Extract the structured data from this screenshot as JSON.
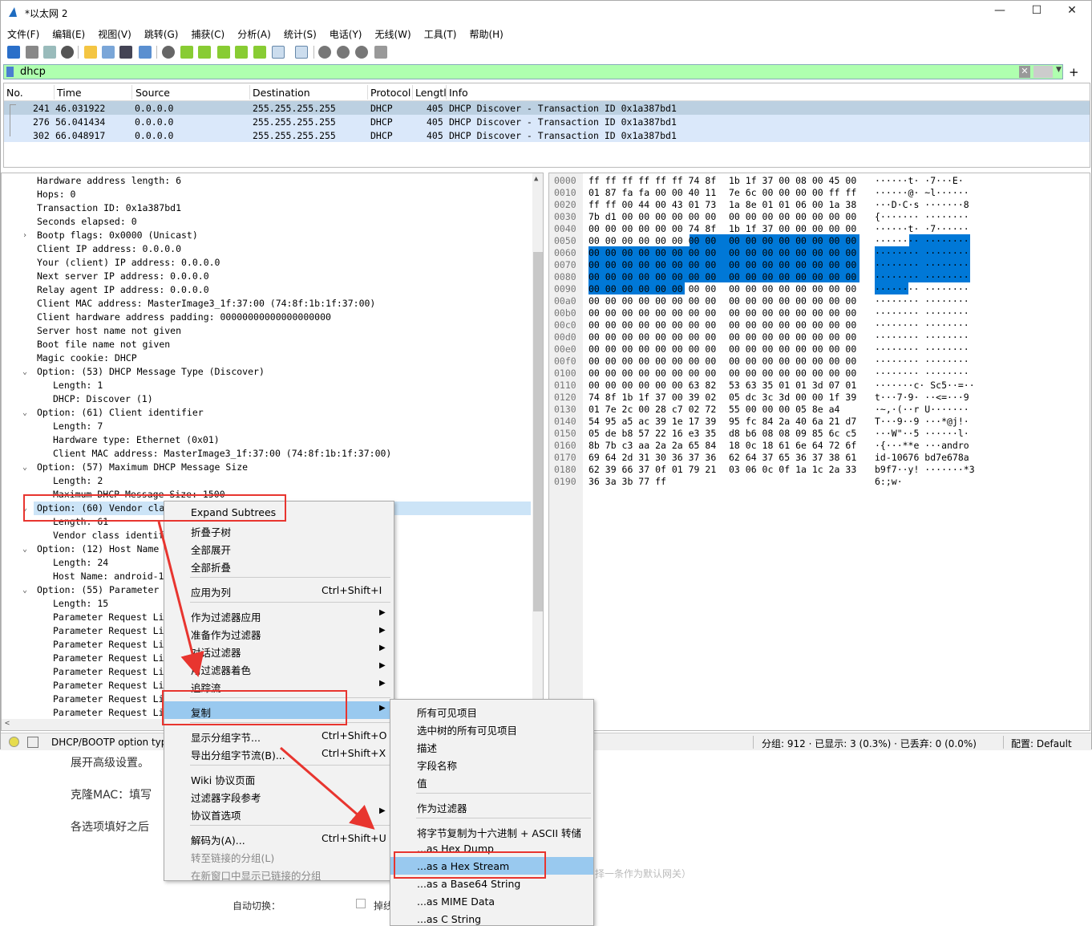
{
  "window": {
    "title": "*以太网 2",
    "minimize": "—",
    "maximize": "☐",
    "close": "✕"
  },
  "menubar": [
    "文件(F)",
    "编辑(E)",
    "视图(V)",
    "跳转(G)",
    "捕获(C)",
    "分析(A)",
    "统计(S)",
    "电话(Y)",
    "无线(W)",
    "工具(T)",
    "帮助(H)"
  ],
  "filter": {
    "value": "dhcp"
  },
  "packet_list": {
    "columns": [
      "No.",
      "Time",
      "Source",
      "Destination",
      "Protocol",
      "Lengtl",
      "Info"
    ],
    "rows": [
      {
        "no": "241",
        "time": "46.031922",
        "src": "0.0.0.0",
        "dst": "255.255.255.255",
        "proto": "DHCP",
        "len": "405",
        "info": "DHCP Discover - Transaction ID 0x1a387bd1"
      },
      {
        "no": "276",
        "time": "56.041434",
        "src": "0.0.0.0",
        "dst": "255.255.255.255",
        "proto": "DHCP",
        "len": "405",
        "info": "DHCP Discover - Transaction ID 0x1a387bd1"
      },
      {
        "no": "302",
        "time": "66.048917",
        "src": "0.0.0.0",
        "dst": "255.255.255.255",
        "proto": "DHCP",
        "len": "405",
        "info": "DHCP Discover - Transaction ID 0x1a387bd1"
      }
    ]
  },
  "details": [
    "Hardware address length: 6",
    "Hops: 0",
    "Transaction ID: 0x1a387bd1",
    "Seconds elapsed: 0",
    "Bootp flags: 0x0000 (Unicast)",
    "Client IP address: 0.0.0.0",
    "Your (client) IP address: 0.0.0.0",
    "Next server IP address: 0.0.0.0",
    "Relay agent IP address: 0.0.0.0",
    "Client MAC address: MasterImage3_1f:37:00 (74:8f:1b:1f:37:00)",
    "Client hardware address padding: 00000000000000000000",
    "Server host name not given",
    "Boot file name not given",
    "Magic cookie: DHCP",
    "Option: (53) DHCP Message Type (Discover)",
    "Length: 1",
    "DHCP: Discover (1)",
    "Option: (61) Client identifier",
    "Length: 7",
    "Hardware type: Ethernet (0x01)",
    "Client MAC address: MasterImage3_1f:37:00 (74:8f:1b:1f:37:00)",
    "Option: (57) Maximum DHCP Message Size",
    "Length: 2",
    "Maximum DHCP Message Size: 1500",
    "Option: (60) Vendor cla",
    "Length: 61",
    "Vendor class identif",
    "Option: (12) Host Name",
    "Length: 24",
    "Host Name: android-1",
    "Option: (55) Parameter",
    "Length: 15",
    "Parameter Request Li",
    "Parameter Request Li",
    "Parameter Request Li",
    "Parameter Request Li",
    "Parameter Request Li",
    "Parameter Request Li",
    "Parameter Request Li",
    "Parameter Request Li"
  ],
  "hex": {
    "offsets": [
      "0000",
      "0010",
      "0020",
      "0030",
      "0040",
      "0050",
      "0060",
      "0070",
      "0080",
      "0090",
      "00a0",
      "00b0",
      "00c0",
      "00d0",
      "00e0",
      "00f0",
      "0100",
      "0110",
      "0120",
      "0130",
      "0140",
      "0150",
      "0160",
      "0170",
      "0180",
      "0190"
    ],
    "bytes_a": [
      "ff ff ff ff ff ff 74 8f",
      "01 87 fa fa 00 00 40 11",
      "ff ff 00 44 00 43 01 73",
      "7b d1 00 00 00 00 00 00",
      "00 00 00 00 00 00 74 8f",
      "00 00 00 00 00 00 00 00",
      "00 00 00 00 00 00 00 00",
      "00 00 00 00 00 00 00 00",
      "00 00 00 00 00 00 00 00",
      "00 00 00 00 00 00 00 00",
      "00 00 00 00 00 00 00 00",
      "00 00 00 00 00 00 00 00",
      "00 00 00 00 00 00 00 00",
      "00 00 00 00 00 00 00 00",
      "00 00 00 00 00 00 00 00",
      "00 00 00 00 00 00 00 00",
      "00 00 00 00 00 00 00 00",
      "00 00 00 00 00 00 63 82",
      "74 8f 1b 1f 37 00 39 02",
      "01 7e 2c 00 28 c7 02 72",
      "54 95 a5 ac 39 1e 17 39",
      "05 de b8 57 22 16 e3 35",
      "8b 7b c3 aa 2a 2a 65 84",
      "69 64 2d 31 30 36 37 36",
      "62 39 66 37 0f 01 79 21",
      "36 3a 3b 77 ff"
    ],
    "bytes_b": [
      "1b 1f 37 00 08 00 45 00",
      "7e 6c 00 00 00 00 ff ff",
      "1a 8e 01 01 06 00 1a 38",
      "00 00 00 00 00 00 00 00",
      "1b 1f 37 00 00 00 00 00",
      "00 00 00 00 00 00 00 00",
      "00 00 00 00 00 00 00 00",
      "00 00 00 00 00 00 00 00",
      "00 00 00 00 00 00 00 00",
      "00 00 00 00 00 00 00 00",
      "00 00 00 00 00 00 00 00",
      "00 00 00 00 00 00 00 00",
      "00 00 00 00 00 00 00 00",
      "00 00 00 00 00 00 00 00",
      "00 00 00 00 00 00 00 00",
      "00 00 00 00 00 00 00 00",
      "00 00 00 00 00 00 00 00",
      "53 63 35 01 01 3d 07 01",
      "05 dc 3c 3d 00 00 1f 39",
      "55 00 00 00 05 8e a4",
      "95 fc 84 2a 40 6a 21 d7",
      "d8 b6 08 08 09 85 6c c5",
      "18 0c 18 61 6e 64 72 6f",
      "62 64 37 65 36 37 38 61",
      "03 06 0c 0f 1a 1c 2a 33",
      ""
    ],
    "ascii": [
      "······t· ·7···E·",
      "······@· ~l······",
      "···D·C·s ·······8",
      "{······· ········",
      "······t· ·7······",
      "········ ········",
      "········ ········",
      "········ ········",
      "········ ········",
      "········ ········",
      "········ ········",
      "········ ········",
      "········ ········",
      "········ ········",
      "········ ········",
      "········ ········",
      "········ ········",
      "·······c· Sc5··=··",
      "t···7·9· ··<=···9",
      "·~,·(··r U·······",
      "T···9··9 ···*@j!·",
      "···W\"··5 ······l·",
      "·{···**e ···andro",
      "id-10676 bd7e678a",
      "b9f7··y! ·······*3",
      "6:;w·"
    ]
  },
  "status": {
    "left": "DHCP/BOOTP option typ",
    "stats": "分组: 912 · 已显示: 3 (0.3%) · 已丢弃: 0 (0.0%)",
    "profile": "配置: Default"
  },
  "context_menu": {
    "items": [
      {
        "label": "Expand Subtrees"
      },
      {
        "label": "折叠子树"
      },
      {
        "label": "全部展开"
      },
      {
        "label": "全部折叠"
      },
      {
        "label": "应用为列",
        "shortcut": "Ctrl+Shift+I"
      },
      {
        "label": "作为过滤器应用"
      },
      {
        "label": "准备作为过滤器"
      },
      {
        "label": "对话过滤器"
      },
      {
        "label": "用过滤器着色"
      },
      {
        "label": "追踪流"
      },
      {
        "label": "复制"
      },
      {
        "label": "显示分组字节...",
        "shortcut": "Ctrl+Shift+O"
      },
      {
        "label": "导出分组字节流(B)...",
        "shortcut": "Ctrl+Shift+X"
      },
      {
        "label": "Wiki 协议页面"
      },
      {
        "label": "过滤器字段参考"
      },
      {
        "label": "协议首选项"
      },
      {
        "label": "解码为(A)...",
        "shortcut": "Ctrl+Shift+U"
      },
      {
        "label": "转至链接的分组(L)"
      },
      {
        "label": "在新窗口中显示已链接的分组"
      }
    ]
  },
  "copy_submenu": {
    "items": [
      "所有可见项目",
      "选中树的所有可见项目",
      "描述",
      "字段名称",
      "值",
      "作为过滤器",
      "将字节复制为十六进制 + ASCII 转储",
      "...as Hex Dump",
      "...as a Hex Stream",
      "...as a Base64 String",
      "...as MIME Data",
      "...as C String"
    ]
  },
  "background_doc": {
    "line1": "展开高级设置。",
    "line2": "克隆MAC：填写",
    "line3": "各选项填好之后",
    "faded": "择一条作为默认网关）",
    "auto_switch": "自动切换：",
    "fragment": "掉线"
  },
  "colors": {
    "accent_red": "#e8352f",
    "selection_blue": "#0078d7",
    "filter_green": "#afffaf",
    "row_selected": "#bcd0e1",
    "menu_hilite": "#99c9ef"
  }
}
